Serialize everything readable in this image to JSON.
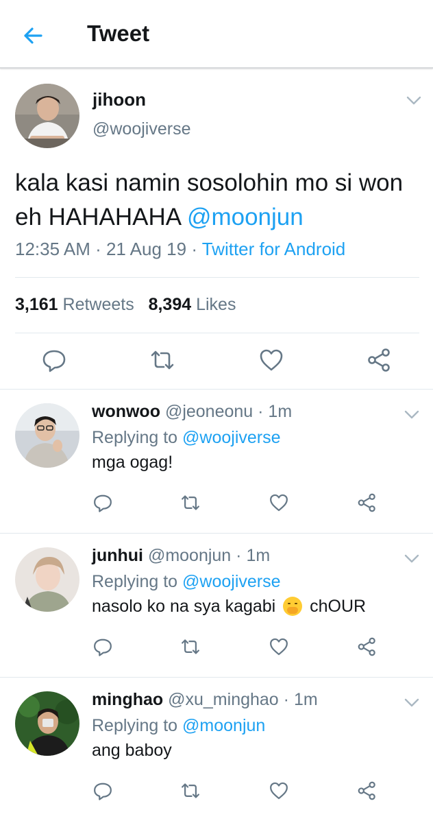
{
  "header": {
    "title": "Tweet",
    "back_icon": "back-arrow-icon"
  },
  "colors": {
    "accent": "#1da1f2",
    "muted": "#657786",
    "text": "#14171a",
    "divider": "#e1e8ed"
  },
  "main_tweet": {
    "name": "jihoon",
    "handle": "@woojiverse",
    "text_before": "kala kasi namin sosolohin mo si won eh HAHAHAHA ",
    "mention": "@moonjun",
    "time": "12:35 AM",
    "date": "21 Aug 19",
    "source": "Twitter for Android",
    "sep": " · ",
    "retweets_count": "3,161",
    "retweets_label": "Retweets",
    "likes_count": "8,394",
    "likes_label": "Likes"
  },
  "replies": [
    {
      "name": "wonwoo",
      "handle": "@jeoneonu",
      "time": "1m",
      "replying_label": "Replying to",
      "replying_to": "@woojiverse",
      "text": "mga ogag!",
      "text_after": ""
    },
    {
      "name": "junhui",
      "handle": "@moonjun",
      "time": "1m",
      "replying_label": "Replying to",
      "replying_to": "@woojiverse",
      "text": "nasolo ko na sya kagabi",
      "emoji": "hand-over-mouth-emoji",
      "text_after": "chOUR"
    },
    {
      "name": "minghao",
      "handle": "@xu_minghao",
      "time": "1m",
      "replying_label": "Replying to",
      "replying_to": "@moonjun",
      "text": "ang baboy",
      "text_after": ""
    }
  ]
}
